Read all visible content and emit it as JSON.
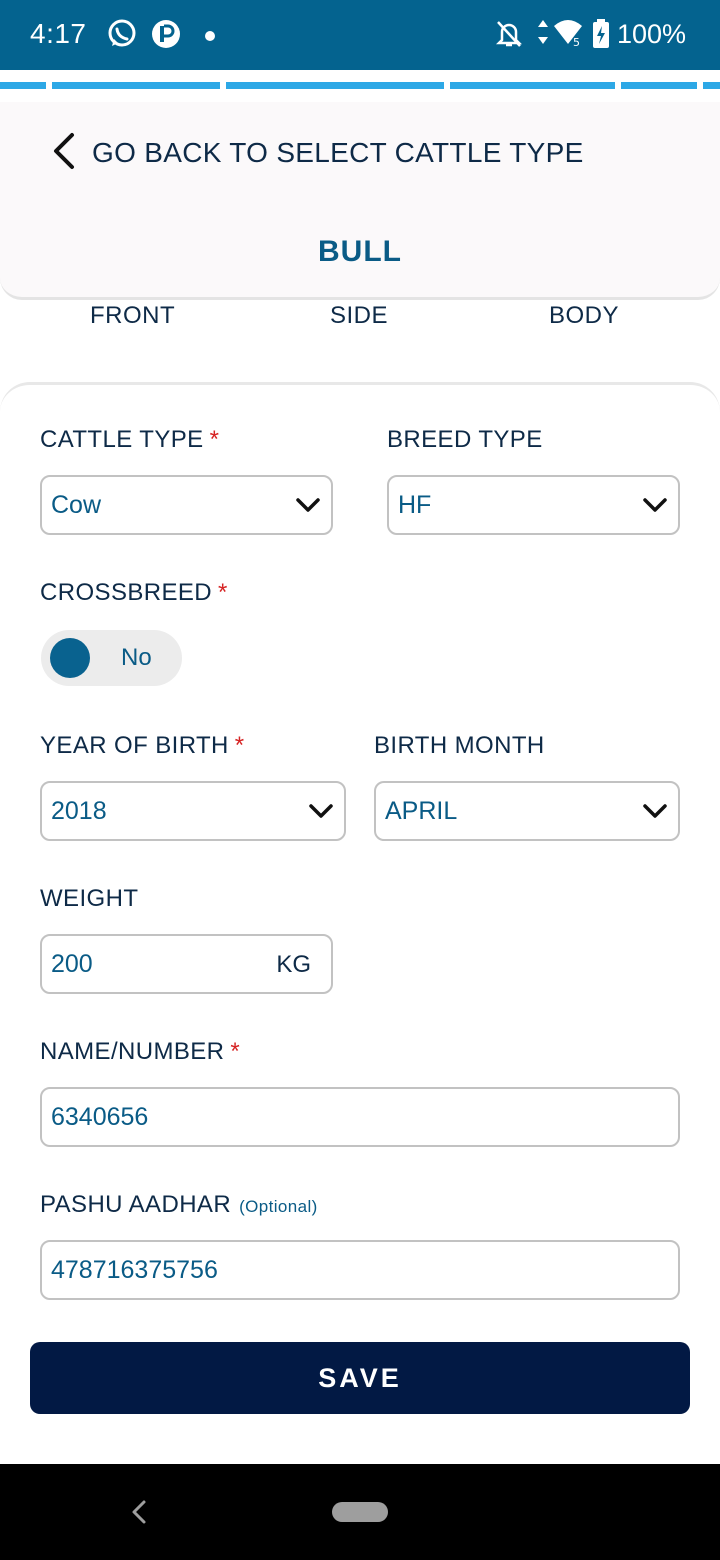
{
  "status_bar": {
    "time": "4:17",
    "battery": "100%"
  },
  "header": {
    "back_label": "GO BACK TO SELECT CATTLE TYPE",
    "title": "BULL"
  },
  "view_tabs": [
    "FRONT",
    "SIDE",
    "BODY"
  ],
  "form": {
    "cattle_type": {
      "label": "CATTLE TYPE",
      "required": "*",
      "value": "Cow"
    },
    "breed_type": {
      "label": "BREED TYPE",
      "value": "HF"
    },
    "crossbreed": {
      "label": "CROSSBREED",
      "required": "*",
      "value": "No"
    },
    "year_of_birth": {
      "label": "YEAR OF BIRTH",
      "required": "*",
      "value": "2018"
    },
    "birth_month": {
      "label": "BIRTH MONTH",
      "value": "APRIL"
    },
    "weight": {
      "label": "WEIGHT",
      "value": "200",
      "unit": "KG"
    },
    "name_number": {
      "label": "NAME/NUMBER",
      "required": "*",
      "value": "6340656"
    },
    "pashu_aadhar": {
      "label": "PASHU AADHAR",
      "optional": "(Optional)",
      "value": "478716375756"
    },
    "save_label": "SAVE"
  },
  "colors": {
    "status_bar": "#04638f",
    "accent": "#0a5b86",
    "tab_indicator": "#2da8e6",
    "save_button": "#021944",
    "required": "#d62424"
  }
}
